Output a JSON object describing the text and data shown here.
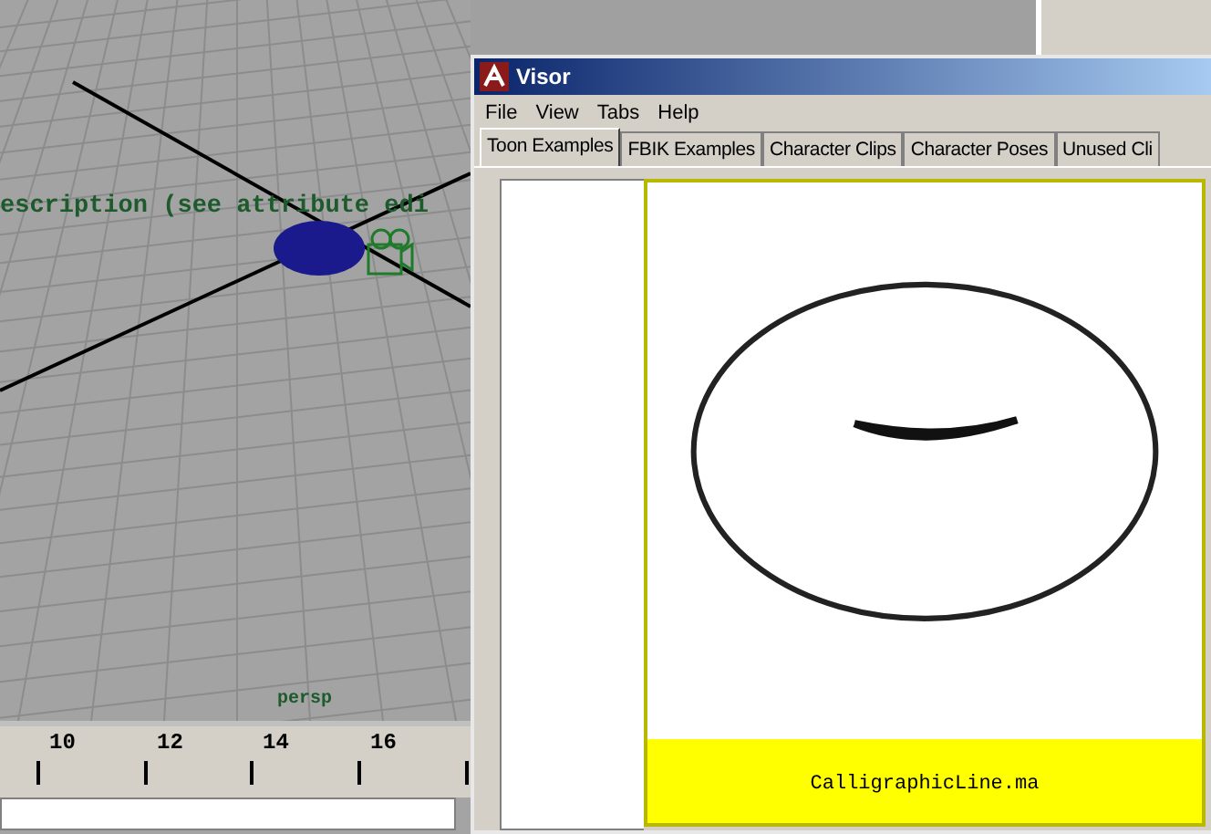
{
  "viewport": {
    "overlay_text": "escription (see attribute edi",
    "camera_label": "persp"
  },
  "timeline": {
    "ticks": [
      "10",
      "12",
      "14",
      "16"
    ]
  },
  "visor": {
    "title": "Visor",
    "menu": [
      "File",
      "View",
      "Tabs",
      "Help"
    ],
    "tabs": [
      {
        "label": "Toon Examples",
        "selected": true
      },
      {
        "label": "FBIK Examples",
        "selected": false
      },
      {
        "label": "Character Clips",
        "selected": false
      },
      {
        "label": "Character Poses",
        "selected": false
      },
      {
        "label": "Unused Cli",
        "selected": false
      }
    ],
    "items": [
      {
        "caption": "CalligraphicLine.ma",
        "selected": true
      }
    ]
  }
}
